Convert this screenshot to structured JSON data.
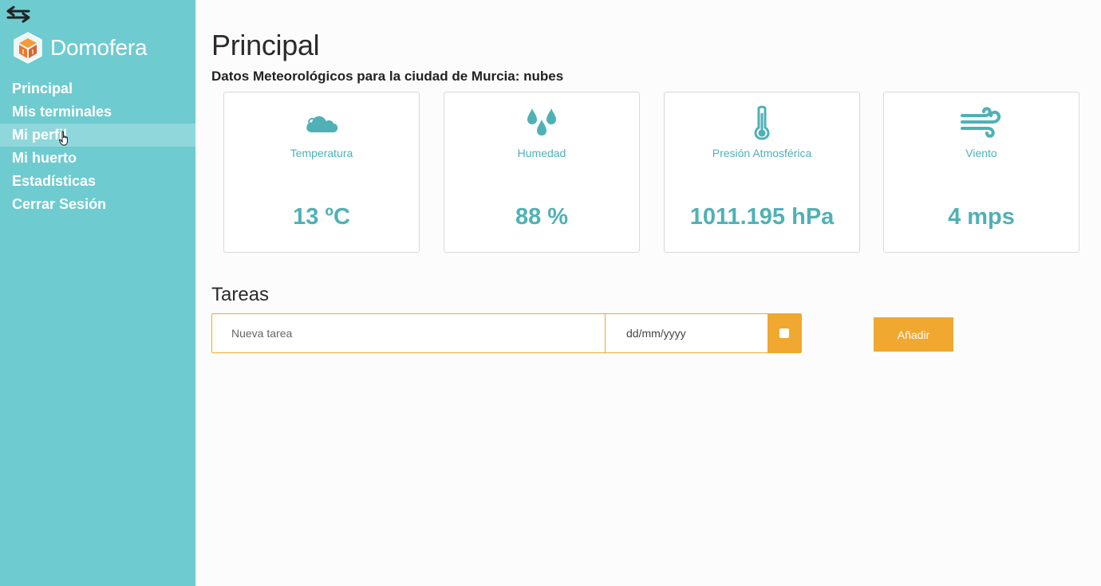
{
  "app": {
    "name": "Domofera"
  },
  "sidebar": {
    "items": [
      {
        "label": "Principal"
      },
      {
        "label": "Mis terminales"
      },
      {
        "label": "Mi perfil"
      },
      {
        "label": "Mi huerto"
      },
      {
        "label": "Estadísticas"
      },
      {
        "label": "Cerrar Sesión"
      }
    ]
  },
  "main": {
    "title": "Principal",
    "weather_subtitle": "Datos Meteorológicos para la ciudad de Murcia: nubes",
    "cards": [
      {
        "label": "Temperatura",
        "value": "13 ºC",
        "icon": "cloud-icon"
      },
      {
        "label": "Humedad",
        "value": "88 %",
        "icon": "droplets-icon"
      },
      {
        "label": "Presión Atmosférica",
        "value": "1011.195 hPa",
        "icon": "thermometer-icon"
      },
      {
        "label": "Viento",
        "value": "4 mps",
        "icon": "wind-icon"
      }
    ],
    "tasks": {
      "title": "Tareas",
      "task_placeholder": "Nueva tarea",
      "date_placeholder": "dd/mm/yyyy",
      "add_label": "Añadir"
    }
  },
  "colors": {
    "sidebar": "#6ecbd0",
    "accent": "#4fb1b6",
    "orange": "#f0a830"
  }
}
